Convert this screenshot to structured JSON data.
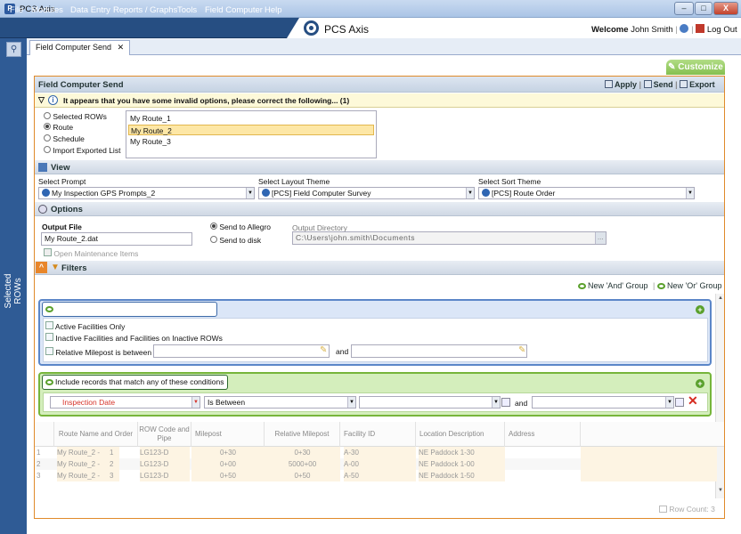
{
  "window": {
    "title": "PCS Axis",
    "min": "–",
    "max": "□",
    "close": "X"
  },
  "menu": [
    "File",
    "Modules",
    "Data Entry",
    "Reports / Graphs",
    "Tools",
    "Field Computer",
    "Help"
  ],
  "brand": "PCS Axis",
  "user": {
    "welcome": "Welcome",
    "name": "John Smith",
    "logout": "Log Out"
  },
  "sidebar": {
    "label": "Selected ROWs"
  },
  "tab": {
    "label": "Field Computer Send",
    "close": "✕"
  },
  "customize": "Customize",
  "panel": {
    "title": "Field Computer Send",
    "apply": "Apply",
    "send": "Send",
    "export": "Export"
  },
  "warning": "It appears that you have some invalid options, please correct the following... (1)",
  "source_options": [
    "Selected ROWs",
    "Route",
    "Schedule",
    "Import Exported List"
  ],
  "routes": [
    "My Route_1",
    "My Route_2",
    "My Route_3"
  ],
  "view": {
    "title": "View",
    "prompt_label": "Select Prompt",
    "prompt_value": "My Inspection GPS Prompts_2",
    "layout_label": "Select Layout Theme",
    "layout_value": "[PCS] Field Computer Survey",
    "sort_label": "Select Sort Theme",
    "sort_value": "[PCS] Route Order"
  },
  "options": {
    "title": "Options",
    "output_file_label": "Output File",
    "output_file": "My Route_2.dat",
    "send_allegro": "Send to Allegro",
    "send_disk": "Send to disk",
    "output_dir_label": "Output Directory",
    "output_dir": "C:\\Users\\john.smith\\Documents",
    "open_maint": "Open Maintenance Items"
  },
  "filters": {
    "title": "Filters",
    "new_and": "New 'And' Group",
    "new_or": "New 'Or' Group",
    "active": "Active Facilities Only",
    "inactive": "Inactive Facilities and Facilities on Inactive ROWs",
    "milepost": "Relative Milepost is between",
    "and": "and",
    "group2_name": "Include records that match any of these conditions",
    "field": "Inspection Date",
    "op": "Is Between",
    "and2": "and"
  },
  "grid": {
    "headers": [
      "Route Name and Order",
      "ROW Code and Pipe",
      "Milepost",
      "Relative Milepost",
      "Facility ID",
      "Location Description",
      "Address"
    ],
    "rows": [
      {
        "n": "1",
        "route": "My Route_2 -",
        "ord": "1",
        "row": "LG123-D",
        "mp": "0+30",
        "rmp": "0+30",
        "fid": "A-30",
        "loc": "NE Paddock 1-30"
      },
      {
        "n": "2",
        "route": "My Route_2 -",
        "ord": "2",
        "row": "LG123-D",
        "mp": "0+00",
        "rmp": "5000+00",
        "fid": "A-00",
        "loc": "NE Paddock 1-00"
      },
      {
        "n": "3",
        "route": "My Route_2 -",
        "ord": "3",
        "row": "LG123-D",
        "mp": "0+50",
        "rmp": "0+50",
        "fid": "A-50",
        "loc": "NE Paddock 1-50"
      }
    ],
    "row_count": "Row Count: 3"
  }
}
